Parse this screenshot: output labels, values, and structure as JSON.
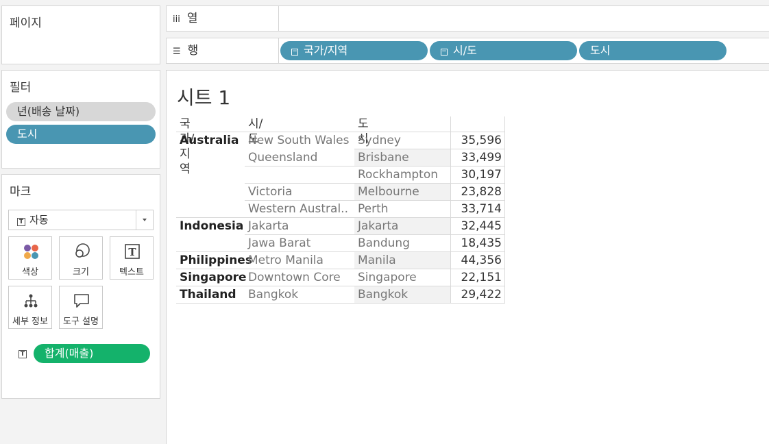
{
  "pages_panel": {
    "title": "페이지"
  },
  "filters_panel": {
    "title": "필터",
    "items": [
      {
        "label": "년(배송 날짜)",
        "style": "grey"
      },
      {
        "label": "도시",
        "style": "blue"
      }
    ]
  },
  "marks_panel": {
    "title": "마크",
    "mark_type": "자동",
    "buttons": [
      {
        "label": "색상",
        "icon": "color-dots-icon"
      },
      {
        "label": "크기",
        "icon": "size-circles-icon"
      },
      {
        "label": "텍스트",
        "icon": "text-box-icon"
      },
      {
        "label": "세부 정보",
        "icon": "detail-tree-icon"
      },
      {
        "label": "도구 설명",
        "icon": "tooltip-bubble-icon"
      }
    ],
    "measure_pill": {
      "label": "합계(매출)",
      "icon": "text-box-icon"
    }
  },
  "columns_shelf": {
    "label": "열",
    "icon": "columns-icon",
    "pills": []
  },
  "rows_shelf": {
    "label": "행",
    "icon": "rows-icon",
    "pills": [
      {
        "label": "국가/지역",
        "collapsible": true
      },
      {
        "label": "시/도",
        "collapsible": true
      },
      {
        "label": "도시",
        "collapsible": false
      }
    ]
  },
  "sheet": {
    "title": "시트 1",
    "headers": [
      "국가/지역",
      "시/도",
      "도시",
      ""
    ],
    "rows": [
      {
        "country": "Australia",
        "state": "New South Wales",
        "city": "Sydney",
        "value": "35,596"
      },
      {
        "country": "",
        "state": "Queensland",
        "city": "Brisbane",
        "value": "33,499"
      },
      {
        "country": "",
        "state": "",
        "city": "Rockhampton",
        "value": "30,197"
      },
      {
        "country": "",
        "state": "Victoria",
        "city": "Melbourne",
        "value": "23,828"
      },
      {
        "country": "",
        "state": "Western Austral..",
        "city": "Perth",
        "value": "33,714"
      },
      {
        "country": "Indonesia",
        "state": "Jakarta",
        "city": "Jakarta",
        "value": "32,445"
      },
      {
        "country": "",
        "state": "Jawa Barat",
        "city": "Bandung",
        "value": "18,435"
      },
      {
        "country": "Philippines",
        "state": "Metro Manila",
        "city": "Manila",
        "value": "44,356"
      },
      {
        "country": "Singapore",
        "state": "Downtown Core",
        "city": "Singapore",
        "value": "22,151"
      },
      {
        "country": "Thailand",
        "state": "Bangkok",
        "city": "Bangkok",
        "value": "29,422"
      }
    ]
  },
  "colors": {
    "dimension_pill": "#4996b2",
    "measure_pill": "#14b26b",
    "filter_pill_grey": "#d7d7d7"
  }
}
